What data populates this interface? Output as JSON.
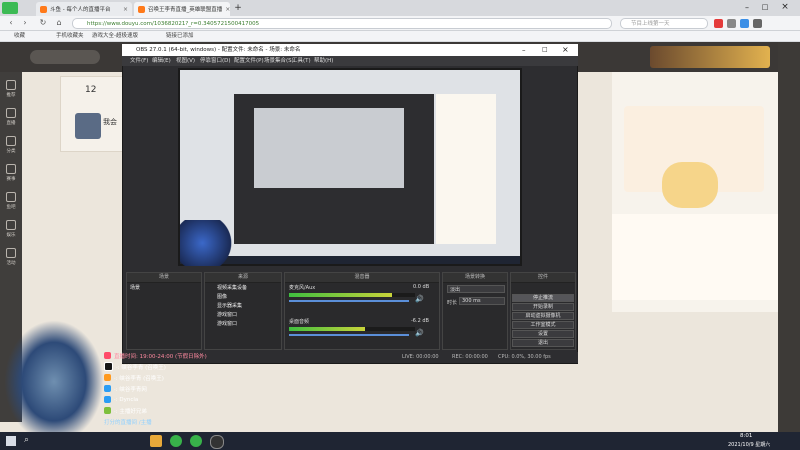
{
  "browser": {
    "tabs": [
      {
        "label": "斗鱼 - 每个人的直播平台",
        "color": "#ff7a1a"
      },
      {
        "label": "召唤王李青直播_英雄联盟直播",
        "color": "#ff7a1a"
      }
    ],
    "new_tab": "+",
    "url": "https://www.douyu.com/103682021?_r=0.3405721500417005",
    "search_placeholder": "节目上线第一天",
    "bookmarks": [
      "收藏",
      "手机收藏夹",
      "游戏大全-超极速版",
      "链接已添加"
    ]
  },
  "site": {
    "leftnav": [
      "推荐",
      "直播",
      "分类",
      "赛事",
      "鱼吧",
      "娱乐",
      "活动"
    ],
    "follow_count": "12",
    "room_title": "我会"
  },
  "obs": {
    "title": "OBS 27.0.1 (64-bit, windows) - 配置文件: 未命名 - 场景: 未命名",
    "menu": [
      "文件(F)",
      "编辑(E)",
      "视图(V)",
      "停靠窗口(D)",
      "配置文件(P)",
      "场景集合(S)",
      "工具(T)",
      "帮助(H)"
    ],
    "scene_header": "场景",
    "scene_item": "场景",
    "source_header": "来源",
    "sources": [
      "视频采集设备",
      "图像",
      "显示器采集",
      "游戏窗口",
      "游戏窗口"
    ],
    "mixer_header": "混音器",
    "mixer_channels": [
      {
        "name": "麦克风/Aux",
        "db": "0.0 dB",
        "level": 0.82
      },
      {
        "name": "桌面音频",
        "db": "-6.2 dB",
        "level": 0.6
      }
    ],
    "transition_header": "场景转换",
    "transition_value": "淡出",
    "duration_label": "时长",
    "duration_value": "300 ms",
    "controls_header": "控件",
    "controls": [
      "停止推流",
      "开始录制",
      "启动虚拟摄像机",
      "工作室模式",
      "设置",
      "退出"
    ],
    "status": {
      "live": "LIVE: 00:00:00",
      "rec": "REC: 00:00:00",
      "cpu": "CPU: 0.0%, 30.00 fps"
    }
  },
  "overlay": {
    "lines": [
      {
        "text": "直播时间: 19:00-24:00 (节假日除外)",
        "color": "#ff4c6a"
      },
      {
        "text": "·: 峡谷李青 (召唤王)",
        "color": "#161616"
      },
      {
        "text": "·: 峡谷李青 (召唤王)",
        "color": "#ff9a1f"
      },
      {
        "text": "·: 峡谷李青网",
        "color": "#2a9df4"
      },
      {
        "text": "·: Dyncla",
        "color": "#2a9df4"
      },
      {
        "text": "·: 主播好兄弟",
        "color": "#7dbf3b"
      },
      {
        "text": "打分的直播间 /主播",
        "color": "#2a9df4"
      }
    ]
  },
  "taskbar": {
    "time": "8:01",
    "date": "2021/10/9 星期六"
  }
}
